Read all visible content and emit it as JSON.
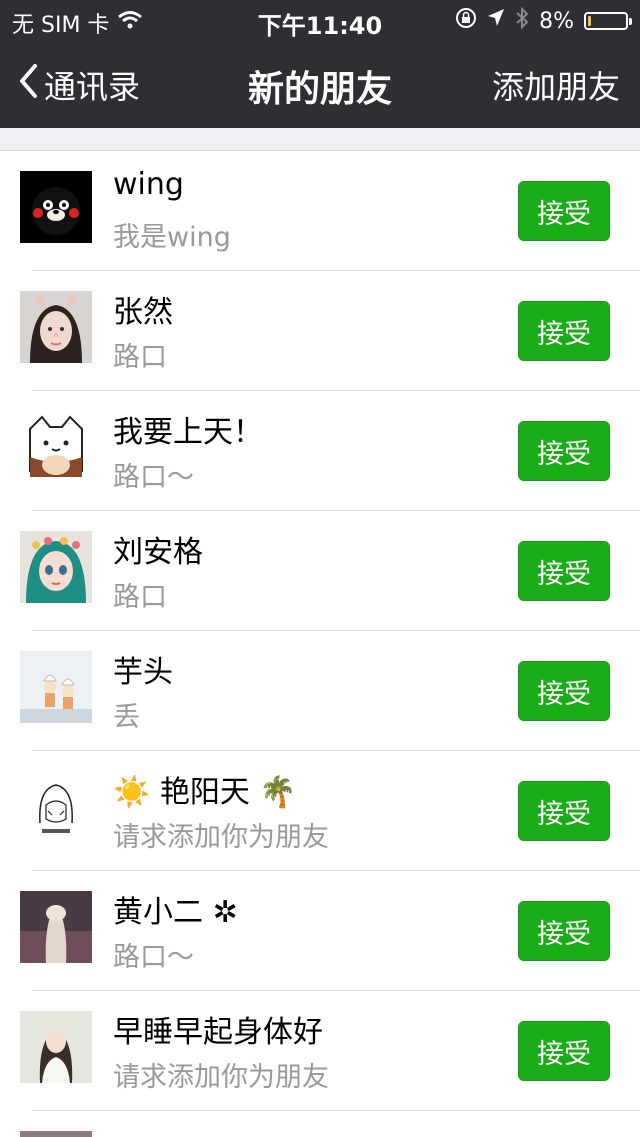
{
  "status_bar": {
    "carrier": "无 SIM 卡",
    "time": "下午11:40",
    "battery": "8%",
    "icons": [
      "wifi-icon",
      "orientation-lock-icon",
      "location-icon",
      "bluetooth-icon",
      "battery-icon"
    ]
  },
  "nav": {
    "back_label": "通讯录",
    "title": "新的朋友",
    "action_label": "添加朋友"
  },
  "colors": {
    "nav_bg": "#2e2e33",
    "accept_bg": "#1aad19",
    "sub_text": "#9a9a9a"
  },
  "requests": [
    {
      "name": "wing",
      "message": "我是wing",
      "button": "接受",
      "avatar": "kumamon-avatar"
    },
    {
      "name": "张然",
      "message": "路口",
      "button": "接受",
      "avatar": "girl-cat-ears-avatar"
    },
    {
      "name": "我要上天！",
      "message": "路口～",
      "button": "接受",
      "avatar": "cartoon-cat-avatar"
    },
    {
      "name": "刘安格",
      "message": "路口",
      "button": "接受",
      "avatar": "doll-avatar"
    },
    {
      "name": "芋头",
      "message": "丢",
      "button": "接受",
      "avatar": "chef-figure-avatar"
    },
    {
      "name": "☀️ 艳阳天 🌴",
      "message": "请求添加你为朋友",
      "button": "接受",
      "avatar": "sketch-girl-avatar"
    },
    {
      "name": "黄小二 ✲",
      "message": "路口～",
      "button": "接受",
      "avatar": "photo-avatar"
    },
    {
      "name": "早睡早起身体好",
      "message": "请求添加你为朋友",
      "button": "接受",
      "avatar": "woman-avatar"
    }
  ]
}
